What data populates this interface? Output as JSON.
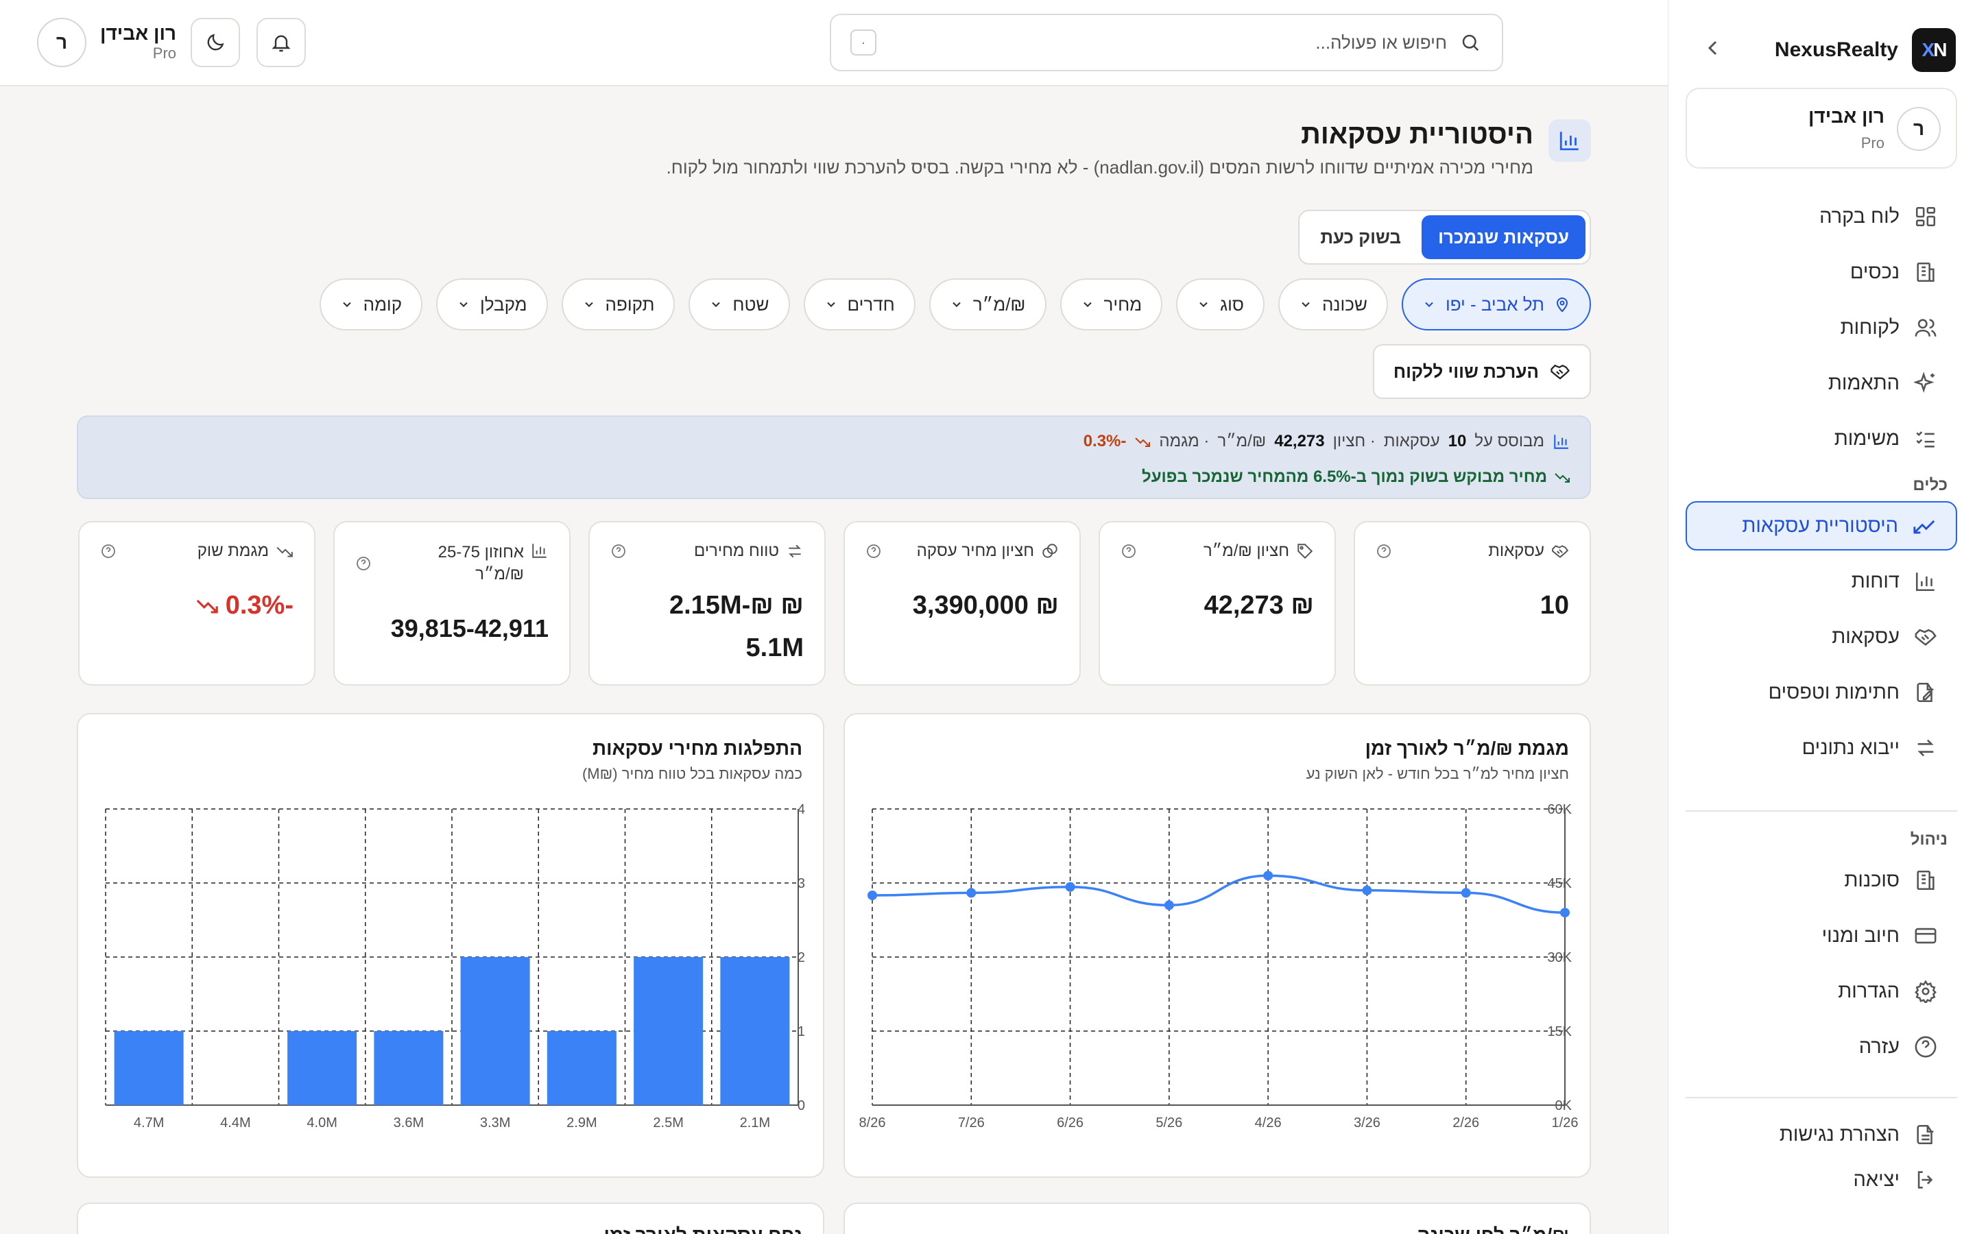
{
  "brand": {
    "name": "NexusRealty",
    "logo": "NX"
  },
  "user": {
    "name": "רון אבידן",
    "plan": "Pro",
    "initial": "ר"
  },
  "nav": {
    "items": [
      {
        "label": "לוח בקרה",
        "icon": "dashboard-icon"
      },
      {
        "label": "נכסים",
        "icon": "building-icon"
      },
      {
        "label": "לקוחות",
        "icon": "users-icon"
      },
      {
        "label": "התאמות",
        "icon": "sparkles-icon"
      },
      {
        "label": "משימות",
        "icon": "checklist-icon"
      }
    ],
    "tools_title": "כלים",
    "tools": [
      {
        "label": "היסטוריית עסקאות",
        "icon": "trend-icon",
        "active": true
      },
      {
        "label": "דוחות",
        "icon": "bar-chart-icon"
      },
      {
        "label": "עסקאות",
        "icon": "handshake-icon"
      },
      {
        "label": "חתימות וטפסים",
        "icon": "pen-document-icon"
      },
      {
        "label": "ייבוא נתונים",
        "icon": "arrows-icon"
      }
    ],
    "admin_title": "ניהול",
    "admin": [
      {
        "label": "סוכנות",
        "icon": "building-icon"
      },
      {
        "label": "חיוב ומנוי",
        "icon": "credit-card-icon"
      },
      {
        "label": "הגדרות",
        "icon": "gear-icon"
      },
      {
        "label": "עזרה",
        "icon": "help-icon"
      }
    ],
    "bottom": [
      {
        "label": "הצהרת נגישות",
        "icon": "document-icon"
      },
      {
        "label": "יציאה",
        "icon": "logout-icon"
      }
    ]
  },
  "topbar": {
    "search_placeholder": "חיפוש או פעולה...",
    "kbd": "·"
  },
  "page": {
    "title": "היסטוריית עסקאות",
    "subtitle": "מחירי מכירה אמיתיים שדווחו לרשות המסים (nadlan.gov.il) - לא מחירי בקשה. בסיס להערכת שווי ולתמחור מול לקוח.",
    "tabs": [
      "עסקאות שנמכרו",
      "בשוק כעת"
    ],
    "active_tab": 0,
    "filters": [
      "תל אביב - יפו",
      "שכונה",
      "סוג",
      "מחיר",
      "₪/מ״ר",
      "חדרים",
      "שטח",
      "תקופה",
      "מקבלן",
      "קומה"
    ],
    "valuation_button": "הערכת שווי ללקוח"
  },
  "banner": {
    "based_on": "מבוסס על",
    "count": "10",
    "deals": "עסקאות",
    "median_label": "· חציון",
    "median": "42,273",
    "unit": "₪/מ״ר",
    "trend_label": "· מגמה",
    "trend": "-0.3%",
    "note": "מחיר מבוקש בשוק נמוך ב-6.5% מהמחיר שנמכר בפועל"
  },
  "kpis": [
    {
      "label": "עסקאות",
      "value": "10",
      "icon": "handshake-icon"
    },
    {
      "label": "חציון ₪/מ״ר",
      "value": "₪ 42,273",
      "icon": "tag-icon"
    },
    {
      "label": "חציון מחיר עסקה",
      "value": "₪ 3,390,000",
      "icon": "coins-icon"
    },
    {
      "label": "טווח מחירים",
      "value": "₪ 2.15M-₪ 5.1M",
      "icon": "swap-icon"
    },
    {
      "label": "אחוזון 25-75 ₪/מ״ר",
      "value": "39,815-42,911",
      "icon": "bar-chart-icon"
    },
    {
      "label": "מגמת שוק",
      "value": "-0.3%",
      "icon": "trend-down-icon",
      "negative": true
    }
  ],
  "charts": {
    "line": {
      "title": "מגמת ₪/מ״ר לאורך זמן",
      "subtitle": "חציון מחיר למ״ר בכל חודש - לאן השוק נע"
    },
    "bar": {
      "title": "התפלגות מחירי עסקאות",
      "subtitle": "כמה עסקאות בכל טווח מחיר (₪M)"
    },
    "bottom_left": "נפח עסקאות לאורך זמן",
    "bottom_right": "₪/מ״ר לפי שכונה"
  },
  "chart_data": [
    {
      "type": "line",
      "title": "מגמת ₪/מ״ר לאורך זמן",
      "x": [
        "1/26",
        "2/26",
        "3/26",
        "4/26",
        "5/26",
        "6/26",
        "7/26",
        "8/26"
      ],
      "series": [
        {
          "values": [
            39000,
            43000,
            43500,
            46500,
            40500,
            44200,
            43000,
            42500
          ]
        }
      ],
      "yticks": [
        "0K",
        "15K",
        "30K",
        "45K",
        "60K"
      ],
      "ylim": [
        0,
        60000
      ],
      "grid": true,
      "color": "#3b82f6"
    },
    {
      "type": "bar",
      "title": "התפלגות מחירי עסקאות",
      "categories": [
        "2.1M",
        "2.5M",
        "2.9M",
        "3.3M",
        "3.6M",
        "4.0M",
        "4.4M",
        "4.7M"
      ],
      "values": [
        2,
        2,
        1,
        2,
        1,
        1,
        0,
        1
      ],
      "yticks": [
        "0",
        "1",
        "2",
        "3",
        "4"
      ],
      "ylim": [
        0,
        4
      ],
      "grid": true,
      "color": "#3b82f6"
    }
  ]
}
